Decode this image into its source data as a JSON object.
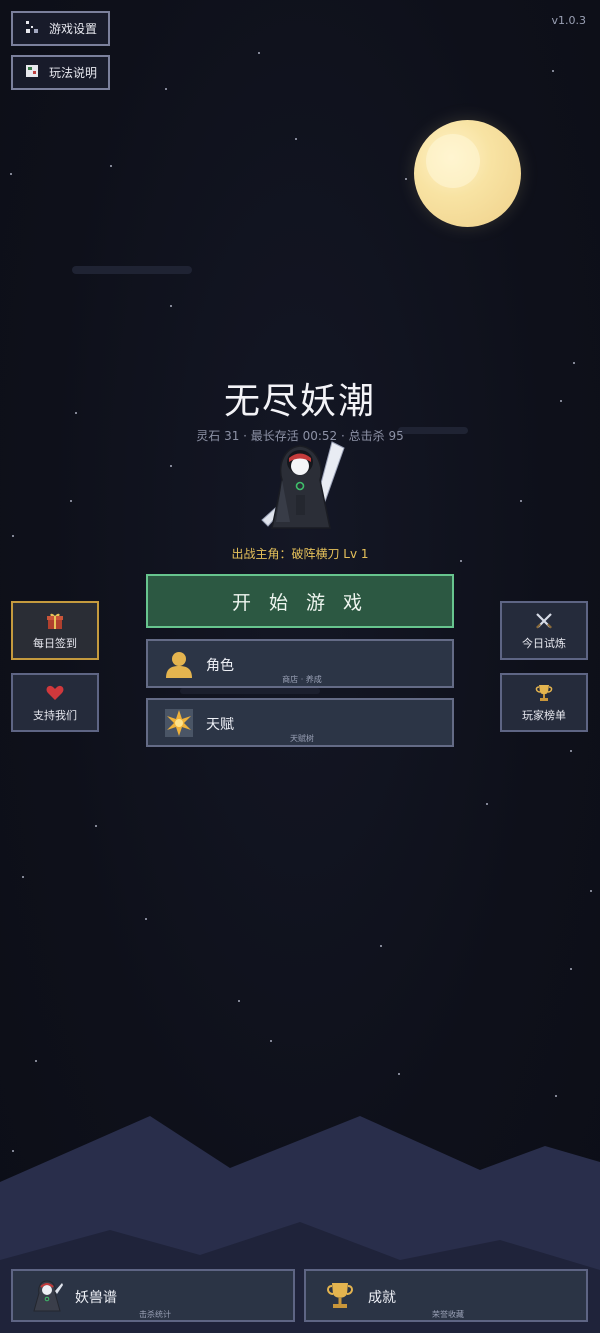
{
  "version": "v1.0.3",
  "top_buttons": {
    "settings_label": "游戏设置",
    "guide_label": "玩法说明"
  },
  "title": "无尽妖潮",
  "stats": {
    "spirit_stones_label": "灵石",
    "spirit_stones": "31",
    "longest_survival_label": "最长存活",
    "longest_survival": "00:52",
    "total_kills_label": "总击杀",
    "total_kills": "95",
    "line": "灵石 31 · 最长存活 00:52 · 总击杀 95"
  },
  "hero": {
    "label": "出战主角：破阵横刀 Lv 1"
  },
  "start_button": "开 始 游 戏",
  "menu": {
    "character": {
      "label": "角色",
      "sub": "商店 · 养成"
    },
    "talent": {
      "label": "天赋",
      "sub": "天赋树"
    }
  },
  "side_left": {
    "daily_checkin": "每日签到",
    "support_us": "支持我们"
  },
  "side_right": {
    "daily_trial": "今日试炼",
    "leaderboard": "玩家榜单"
  },
  "bottom": {
    "bestiary": {
      "label": "妖兽谱",
      "sub": "击杀统计"
    },
    "achievements": {
      "label": "成就",
      "sub": "荣誉收藏"
    }
  },
  "colors": {
    "background": "#0e101a",
    "start_button_fill": "#2c5842",
    "start_button_border": "#67c58e",
    "hero_label": "#e6c15a",
    "moon": "#f8e3a3",
    "mountain": "#2a2f4a"
  },
  "icons": {
    "settings": "settings-icon",
    "guide": "guide-icon",
    "daily_checkin": "gift-icon",
    "support_us": "heart-icon",
    "daily_trial": "crossed-swords-icon",
    "leaderboard": "trophy-icon",
    "character": "person-silhouette-icon",
    "talent": "starburst-icon",
    "bestiary": "monster-icon",
    "achievements": "trophy-icon"
  }
}
